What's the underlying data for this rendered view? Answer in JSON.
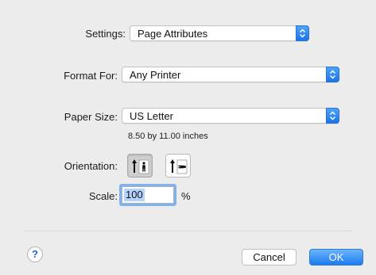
{
  "settings": {
    "label": "Settings:",
    "value": "Page Attributes"
  },
  "format_for": {
    "label": "Format For:",
    "value": "Any Printer"
  },
  "paper_size": {
    "label": "Paper Size:",
    "value": "US Letter",
    "dimensions": "8.50 by 11.00 inches"
  },
  "orientation": {
    "label": "Orientation:",
    "selected": "portrait",
    "options": [
      "portrait-icon",
      "landscape-icon"
    ]
  },
  "scale": {
    "label": "Scale:",
    "value": "100",
    "unit": "%"
  },
  "footer": {
    "help": "?",
    "cancel": "Cancel",
    "ok": "OK"
  },
  "colors": {
    "accent": "#1b7cf0",
    "background": "#ececec",
    "focus_ring": "#7fb2ef"
  }
}
